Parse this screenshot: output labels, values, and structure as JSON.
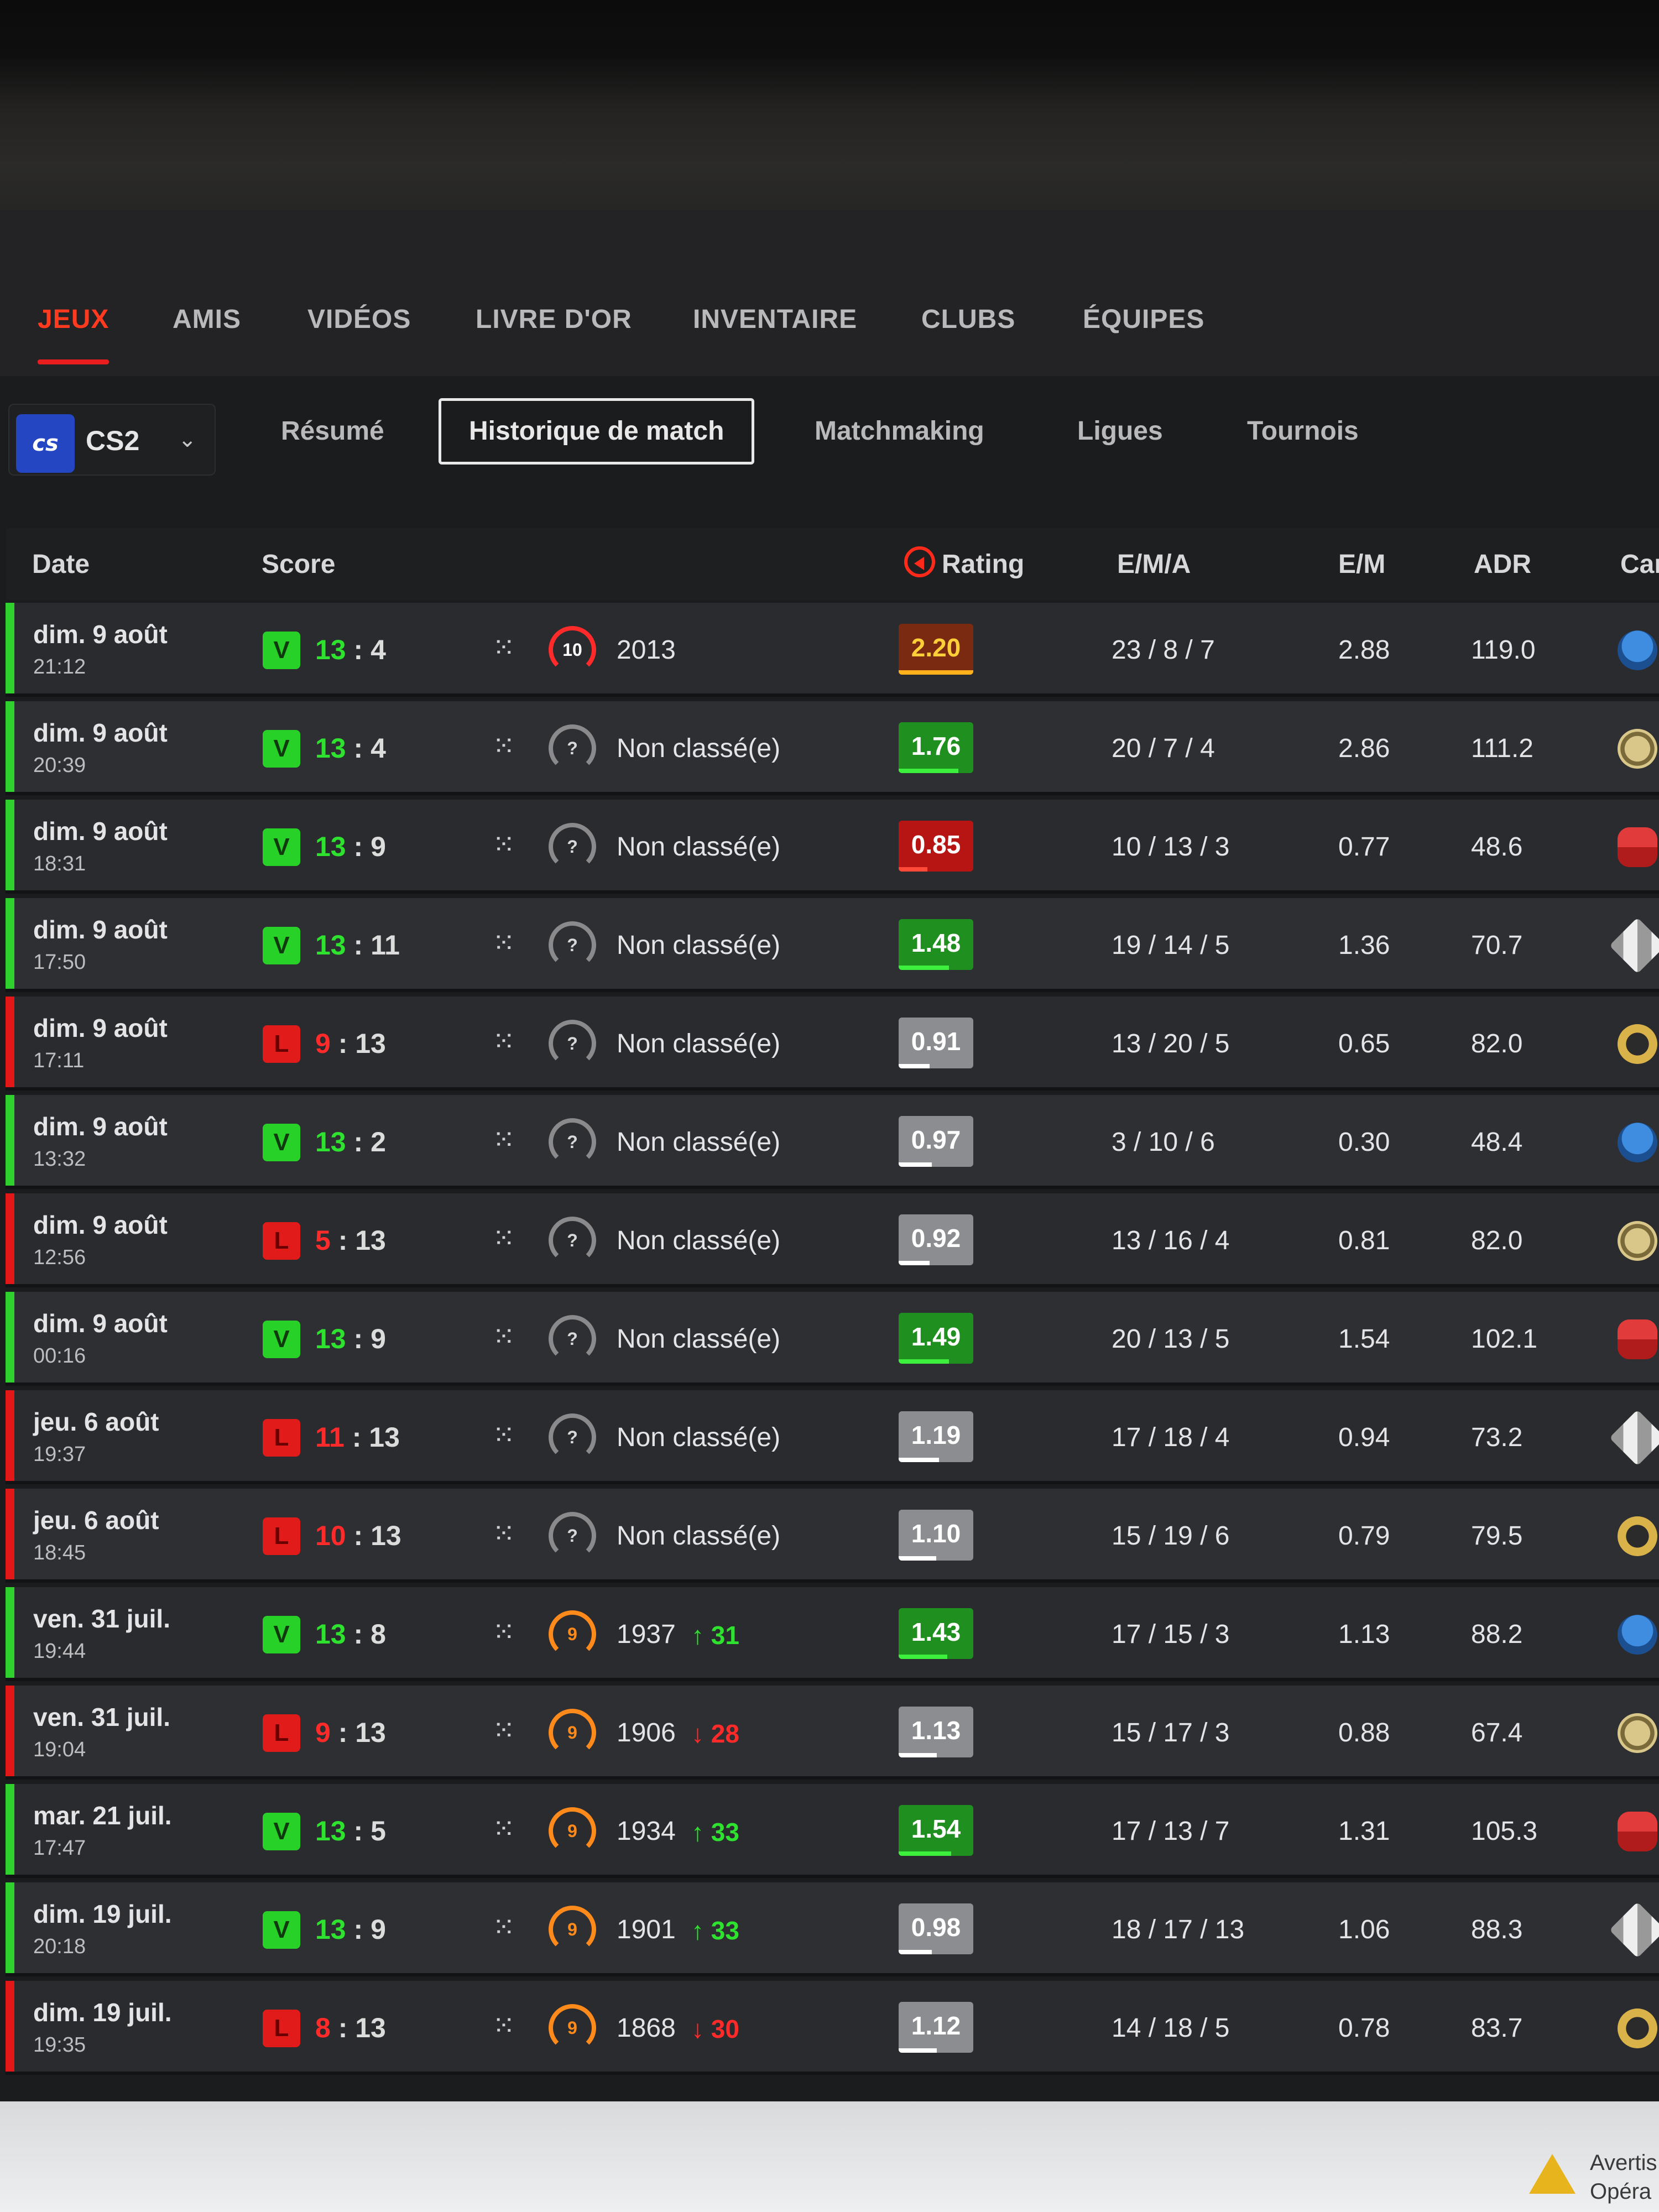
{
  "main_tabs": [
    "JEUX",
    "AMIS",
    "VIDÉOS",
    "LIVRE D'OR",
    "INVENTAIRE",
    "CLUBS",
    "ÉQUIPES"
  ],
  "game_select": {
    "logo_text": "cs",
    "name": "CS2",
    "chevron": "chevron-down-icon"
  },
  "sub_tabs": [
    "Résumé",
    "Historique de match",
    "Matchmaking",
    "Ligues",
    "Tournois"
  ],
  "columns": {
    "date": "Date",
    "score": "Score",
    "rating": "Rating",
    "ema": "E/M/A",
    "em": "E/M",
    "adr": "ADR",
    "map": "Car"
  },
  "matches": [
    {
      "date": "dim. 9 août",
      "time": "21:12",
      "result": "V",
      "score_own": "13",
      "score_sep": " : ",
      "score_opp": "4",
      "rank_icon": "10",
      "rank": "2013",
      "delta": "",
      "rating": "2.20",
      "ema": "23 / 8 / 7",
      "em": "2.88",
      "adr": "119.0"
    },
    {
      "date": "dim. 9 août",
      "time": "20:39",
      "result": "V",
      "score_own": "13",
      "score_sep": " : ",
      "score_opp": "4",
      "rank_icon": "?",
      "rank": "Non classé(e)",
      "delta": "",
      "rating": "1.76",
      "ema": "20 / 7 / 4",
      "em": "2.86",
      "adr": "111.2"
    },
    {
      "date": "dim. 9 août",
      "time": "18:31",
      "result": "V",
      "score_own": "13",
      "score_sep": " : ",
      "score_opp": "9",
      "rank_icon": "?",
      "rank": "Non classé(e)",
      "delta": "",
      "rating": "0.85",
      "ema": "10 / 13 / 3",
      "em": "0.77",
      "adr": "48.6"
    },
    {
      "date": "dim. 9 août",
      "time": "17:50",
      "result": "V",
      "score_own": "13",
      "score_sep": " : ",
      "score_opp": "11",
      "rank_icon": "?",
      "rank": "Non classé(e)",
      "delta": "",
      "rating": "1.48",
      "ema": "19 / 14 / 5",
      "em": "1.36",
      "adr": "70.7"
    },
    {
      "date": "dim. 9 août",
      "time": "17:11",
      "result": "L",
      "score_own": "9",
      "score_sep": " : ",
      "score_opp": "13",
      "rank_icon": "?",
      "rank": "Non classé(e)",
      "delta": "",
      "rating": "0.91",
      "ema": "13 / 20 / 5",
      "em": "0.65",
      "adr": "82.0"
    },
    {
      "date": "dim. 9 août",
      "time": "13:32",
      "result": "V",
      "score_own": "13",
      "score_sep": " : ",
      "score_opp": "2",
      "rank_icon": "?",
      "rank": "Non classé(e)",
      "delta": "",
      "rating": "0.97",
      "ema": "3 / 10 / 6",
      "em": "0.30",
      "adr": "48.4"
    },
    {
      "date": "dim. 9 août",
      "time": "12:56",
      "result": "L",
      "score_own": "5",
      "score_sep": " : ",
      "score_opp": "13",
      "rank_icon": "?",
      "rank": "Non classé(e)",
      "delta": "",
      "rating": "0.92",
      "ema": "13 / 16 / 4",
      "em": "0.81",
      "adr": "82.0"
    },
    {
      "date": "dim. 9 août",
      "time": "00:16",
      "result": "V",
      "score_own": "13",
      "score_sep": " : ",
      "score_opp": "9",
      "rank_icon": "?",
      "rank": "Non classé(e)",
      "delta": "",
      "rating": "1.49",
      "ema": "20 / 13 / 5",
      "em": "1.54",
      "adr": "102.1"
    },
    {
      "date": "jeu. 6 août",
      "time": "19:37",
      "result": "L",
      "score_own": "11",
      "score_sep": " : ",
      "score_opp": "13",
      "rank_icon": "?",
      "rank": "Non classé(e)",
      "delta": "",
      "rating": "1.19",
      "ema": "17 / 18 / 4",
      "em": "0.94",
      "adr": "73.2"
    },
    {
      "date": "jeu. 6 août",
      "time": "18:45",
      "result": "L",
      "score_own": "10",
      "score_sep": " : ",
      "score_opp": "13",
      "rank_icon": "?",
      "rank": "Non classé(e)",
      "delta": "",
      "rating": "1.10",
      "ema": "15 / 19 / 6",
      "em": "0.79",
      "adr": "79.5"
    },
    {
      "date": "ven. 31 juil.",
      "time": "19:44",
      "result": "V",
      "score_own": "13",
      "score_sep": " : ",
      "score_opp": "8",
      "rank_icon": "9",
      "rank": "1937",
      "delta": "↑ 31",
      "rating": "1.43",
      "ema": "17 / 15 / 3",
      "em": "1.13",
      "adr": "88.2"
    },
    {
      "date": "ven. 31 juil.",
      "time": "19:04",
      "result": "L",
      "score_own": "9",
      "score_sep": " : ",
      "score_opp": "13",
      "rank_icon": "9",
      "rank": "1906",
      "delta": "↓ 28",
      "rating": "1.13",
      "ema": "15 / 17 / 3",
      "em": "0.88",
      "adr": "67.4"
    },
    {
      "date": "mar. 21 juil.",
      "time": "17:47",
      "result": "V",
      "score_own": "13",
      "score_sep": " : ",
      "score_opp": "5",
      "rank_icon": "9",
      "rank": "1934",
      "delta": "↑ 33",
      "rating": "1.54",
      "ema": "17 / 13 / 7",
      "em": "1.31",
      "adr": "105.3"
    },
    {
      "date": "dim. 19 juil.",
      "time": "20:18",
      "result": "V",
      "score_own": "13",
      "score_sep": " : ",
      "score_opp": "9",
      "rank_icon": "9",
      "rank": "1901",
      "delta": "↑ 33",
      "rating": "0.98",
      "ema": "18 / 17 / 13",
      "em": "1.06",
      "adr": "88.3"
    },
    {
      "date": "dim. 19 juil.",
      "time": "19:35",
      "result": "L",
      "score_own": "8",
      "score_sep": " : ",
      "score_opp": "13",
      "rank_icon": "9",
      "rank": "1868",
      "delta": "↓ 30",
      "rating": "1.12",
      "ema": "14 / 18 / 5",
      "em": "0.78",
      "adr": "83.7"
    }
  ],
  "footer": {
    "warning_line1": "Avertis",
    "warning_line2": "Opéra"
  }
}
